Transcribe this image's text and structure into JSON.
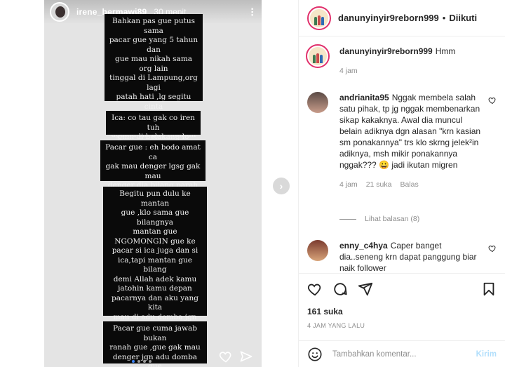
{
  "story": {
    "username": "irene_bermawi89",
    "time": "30 menit",
    "bubbles": [
      "Bahkan pas gue putus sama\npacar gue yang 5 tahun dan\ngue mau nikah sama org lain\ntinggal di Lampung,org lagi\npatah hati ,lg segitu cinta\nmerasa kehilangan pts beda\nagama sm gue mantan gue\nyang 5 tahun mau di cuci\notaknya",
      "Ica: co tau gak co iren tuh\ngmn di belakang lo",
      "Pacar gue : eh bodo amat ca\ngak mau denger lgsg gak mau\ndenger dia bilang parah amat\nKaka  sendiri mau di jelekin",
      "Begitu pun dulu ke mantan\ngue ,klo sama gue bilangnya\nmantan gue\nNGOMONGIN gue ke\npacar si ica juga dan si\nica,tapi mantan gue bilang\ndemi Allah adek kamu\njatohin kamu depan\npacarnya dan aku yang kita\nmau di adu domba jgn\npercaya yang mana ada aku\nmau jahat sm pacar aku\nsendiri....",
      "Pacar gue cuma jawab bukan\nranah gue ,gue gak mau\ndenger jgn adu domba gue\nsm cewe gue .."
    ]
  },
  "header": {
    "username": "danunyinyir9reborn999",
    "separator": "•",
    "follow_status": "Diikuti"
  },
  "caption": {
    "username": "danunyinyir9reborn999",
    "text": "Hmm",
    "time": "4 jam"
  },
  "comments": [
    {
      "username": "andrianita95",
      "text": "Nggak membela salah satu pihak, tp jg nggak membenarkan sikap kakaknya. Awal dia muncul belain adiknya dgn alasan \"krn kasian sm ponakannya\" trs klo skrng jelek²in adiknya, msh mikir ponakannya nggak??? 😀 jadi ikutan migren",
      "time": "4 jam",
      "likes": "21 suka",
      "reply": "Balas",
      "view_replies": "Lihat balasan (8)"
    },
    {
      "username": "enny_c4hya",
      "text": "Caper banget dia..seneng krn dapat panggung biar naik follower"
    }
  ],
  "stats": {
    "likes": "161 suka",
    "posted": "4 JAM YANG LALU"
  },
  "add_comment": {
    "placeholder": "Tambahkan komentar...",
    "post_label": "Kirim"
  }
}
